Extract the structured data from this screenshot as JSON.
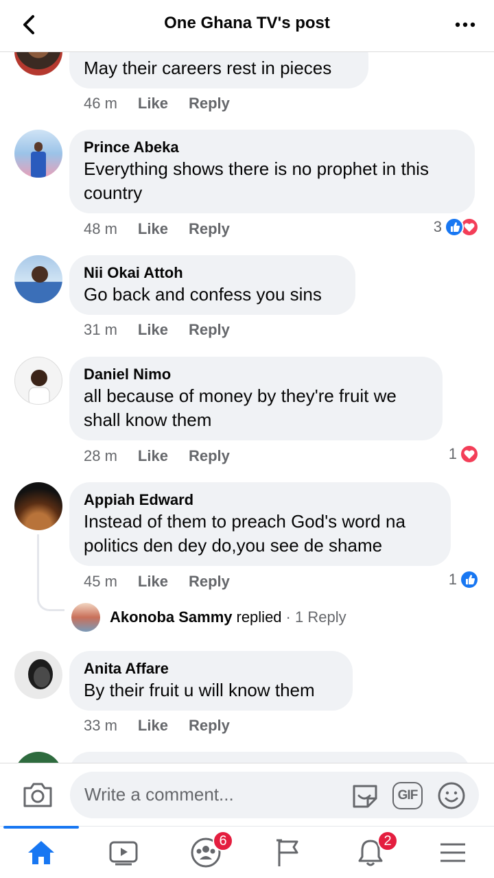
{
  "header": {
    "title": "One Ghana TV's post",
    "back_icon": "back-arrow-icon",
    "more_icon": "more-dots-icon"
  },
  "actions": {
    "like": "Like",
    "reply": "Reply"
  },
  "comments": [
    {
      "name": "",
      "text": "May their careers rest in pieces",
      "time": "46 m",
      "reactions": null
    },
    {
      "name": "Prince Abeka",
      "text_lines": [
        "Everything shows there is no prophet in this",
        "country"
      ],
      "time": "48 m",
      "reactions": {
        "count": "3",
        "types": [
          "like",
          "love"
        ]
      }
    },
    {
      "name": "Nii Okai Attoh",
      "text": "Go back and confess you sins",
      "time": "31 m",
      "reactions": null
    },
    {
      "name": "Daniel Nimo",
      "text_lines": [
        "all because of money by they're fruit we",
        "shall know them"
      ],
      "time": "28 m",
      "reactions": {
        "count": "1",
        "types": [
          "love"
        ]
      }
    },
    {
      "name": "Appiah Edward",
      "text_lines": [
        "Instead of them to preach God's word na",
        "politics den dey do,you see de shame"
      ],
      "time": "45 m",
      "reactions": {
        "count": "1",
        "types": [
          "like"
        ]
      },
      "reply": {
        "name": "Akonoba Sammy",
        "word": "replied",
        "count": "· 1 Reply"
      }
    },
    {
      "name": "Anita Affare",
      "text": "By their fruit u will know them",
      "time": "33 m",
      "reactions": null
    }
  ],
  "composer": {
    "placeholder": "Write a comment...",
    "gif_label": "GIF"
  },
  "nav": {
    "items": [
      {
        "name": "home",
        "icon": "home-icon",
        "active": true
      },
      {
        "name": "watch",
        "icon": "video-icon"
      },
      {
        "name": "groups",
        "icon": "groups-icon",
        "badge": "6"
      },
      {
        "name": "pages",
        "icon": "flag-icon"
      },
      {
        "name": "notifications",
        "icon": "bell-icon",
        "badge": "2"
      },
      {
        "name": "menu",
        "icon": "hamburger-icon"
      }
    ]
  },
  "colors": {
    "accent": "#1877f2",
    "love": "#f33e58",
    "badge": "#e41e3f",
    "bubble": "#f0f2f5",
    "meta": "#65676b"
  }
}
